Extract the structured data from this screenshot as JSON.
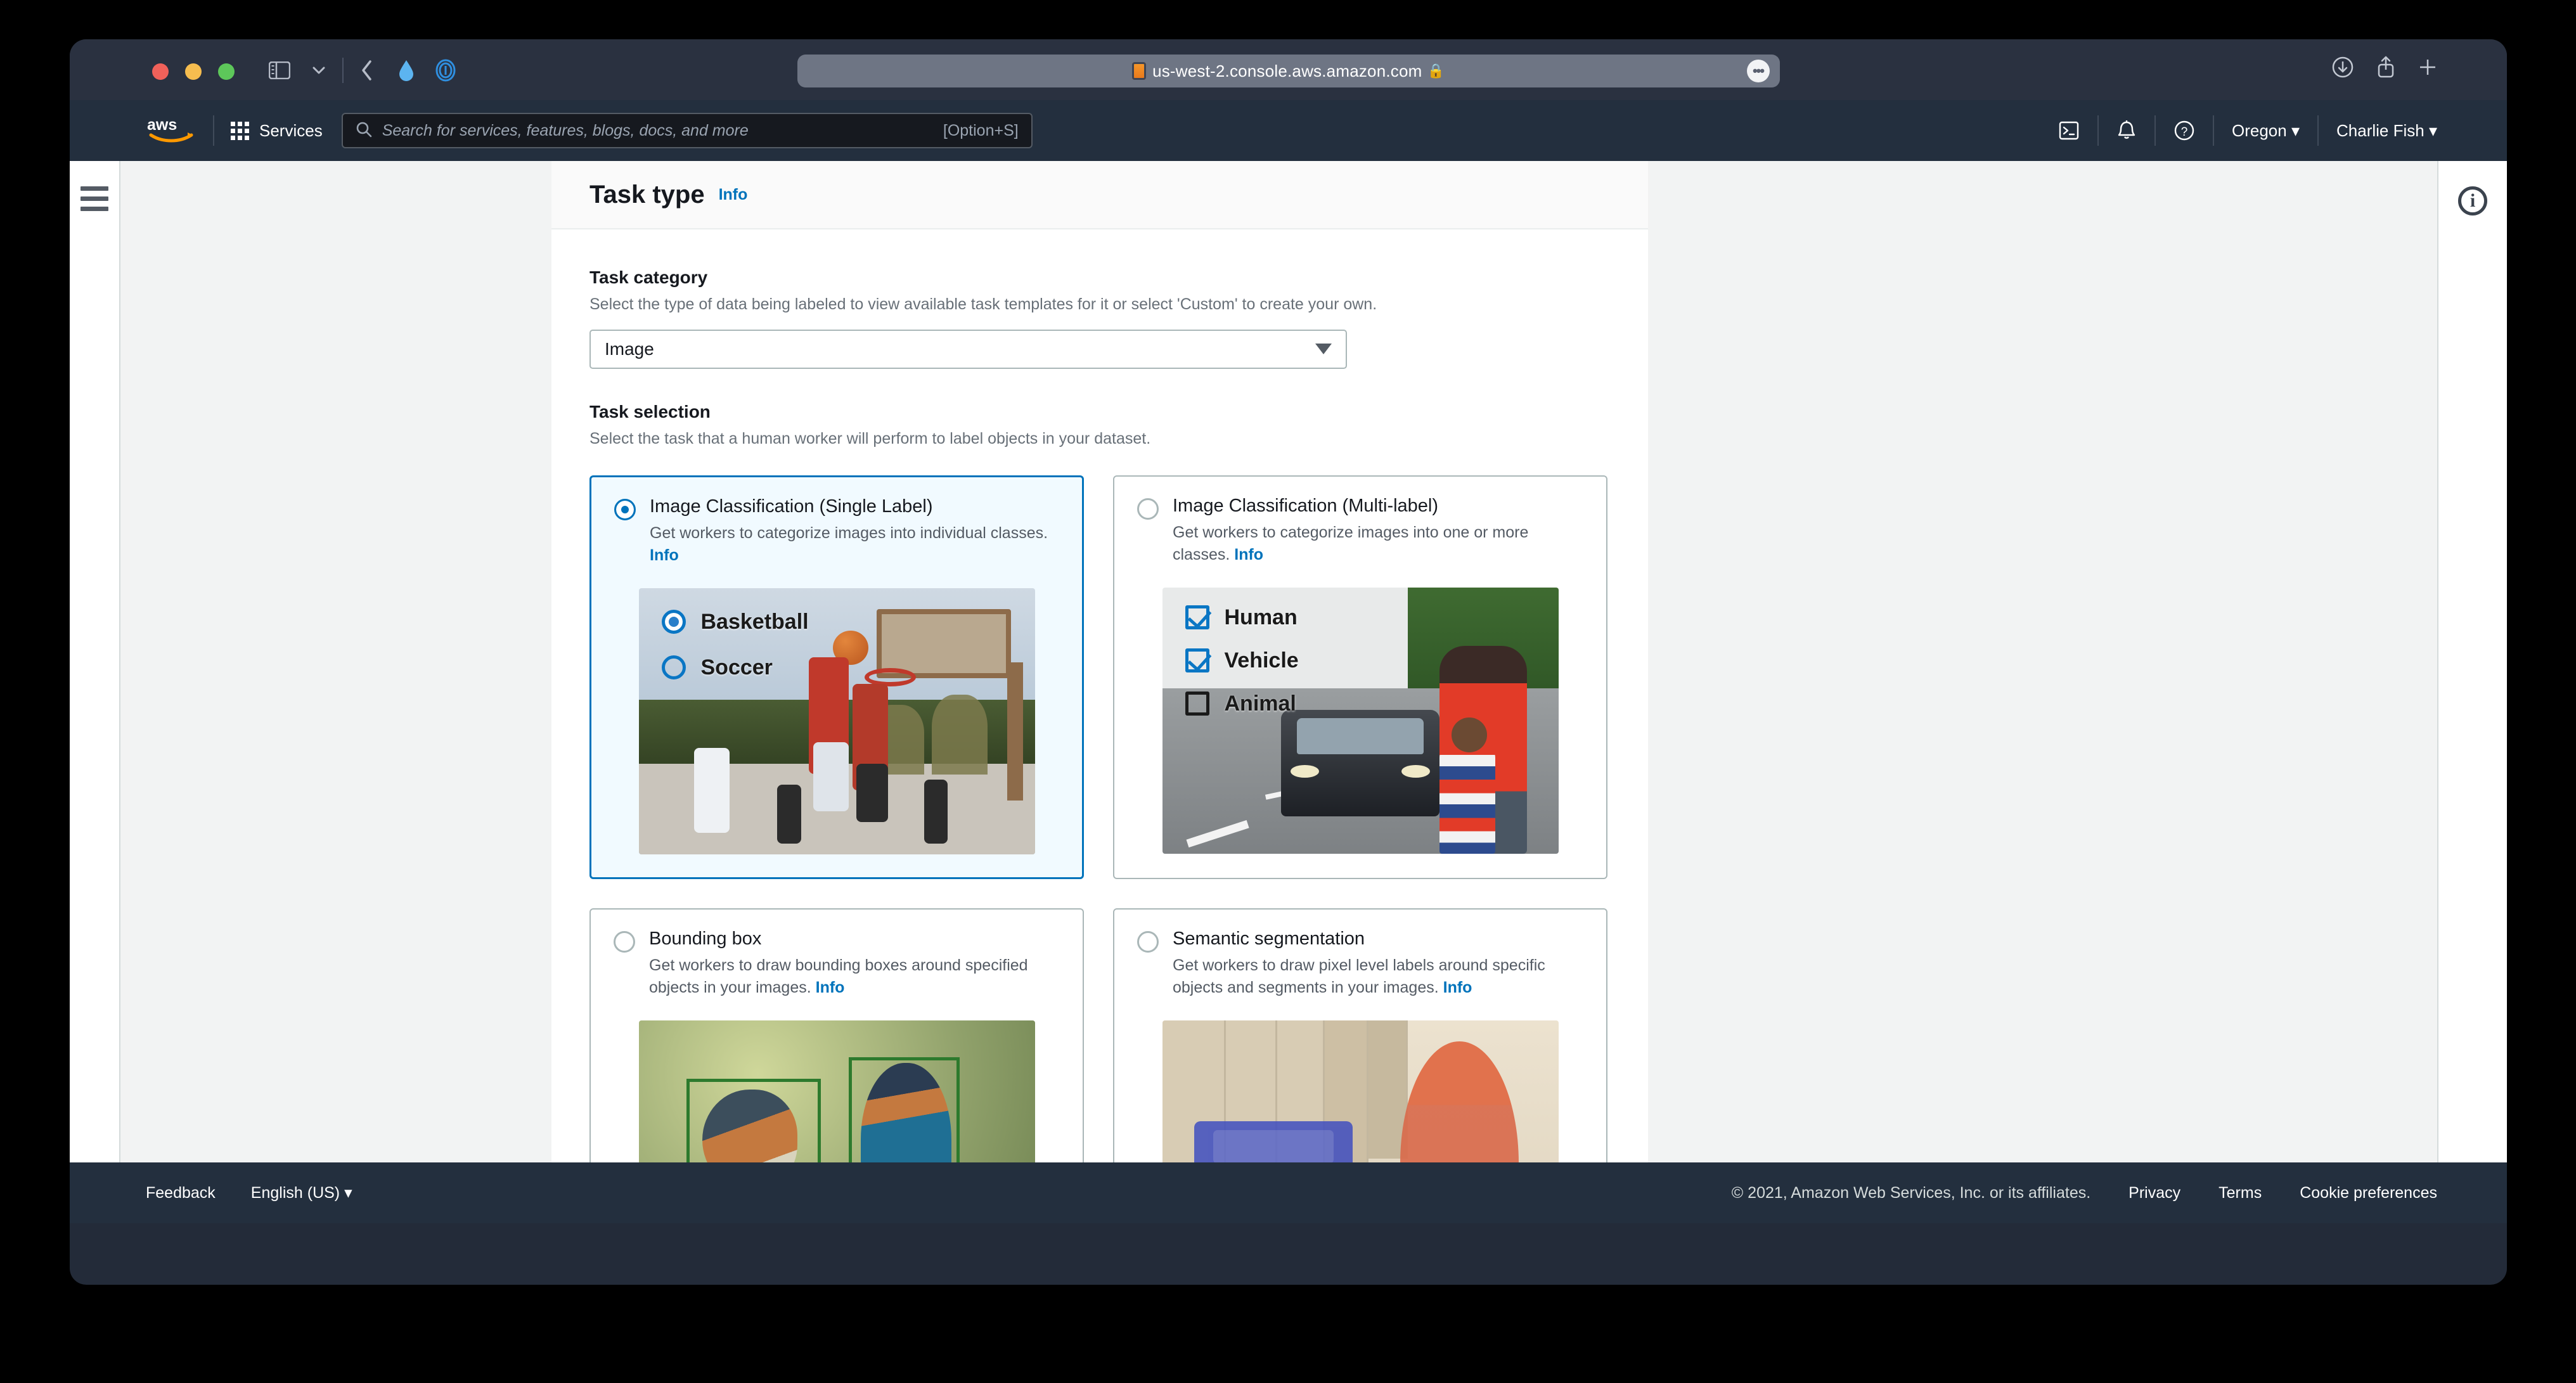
{
  "browser": {
    "url": "us-west-2.console.aws.amazon.com",
    "lock_icon": "lock-icon",
    "favicon": "aws-favicon",
    "traffic_lights": [
      "close",
      "minimize",
      "zoom"
    ],
    "toolbar_icons": [
      "sidebar-toggle-icon",
      "chevron-down-icon",
      "back-icon",
      "extension-icon",
      "privacy-report-icon"
    ],
    "right_icons": [
      "downloads-icon",
      "share-icon",
      "new-tab-icon"
    ],
    "more_icon": "more-icon"
  },
  "awsnav": {
    "logo": "aws-logo",
    "services_label": "Services",
    "search_placeholder": "Search for services, features, blogs, docs, and more",
    "search_shortcut": "[Option+S]",
    "cloudshell_icon": "cloudshell-icon",
    "notifications_icon": "bell-icon",
    "help_icon": "question-circle-icon",
    "region": "Oregon",
    "account": "Charlie Fish"
  },
  "page": {
    "title": "Task type",
    "info_label": "Info",
    "task_category": {
      "label": "Task category",
      "description": "Select the type of data being labeled to view available task templates for it or select 'Custom' to create your own.",
      "value": "Image"
    },
    "task_selection": {
      "label": "Task selection",
      "description": "Select the task that a human worker will perform to label objects in your dataset.",
      "cards": [
        {
          "title": "Image Classification (Single Label)",
          "description": "Get workers to categorize images into individual classes.",
          "info": "Info",
          "selected": true,
          "thumbnail": "basketball-court-photo",
          "overlay_type": "radio",
          "overlay_options": [
            {
              "label": "Basketball",
              "checked": true
            },
            {
              "label": "Soccer",
              "checked": false
            }
          ]
        },
        {
          "title": "Image Classification (Multi-label)",
          "description": "Get workers to categorize images into one or more classes.",
          "info": "Info",
          "selected": false,
          "thumbnail": "road-car-pedestrians-photo",
          "overlay_type": "checkbox",
          "overlay_options": [
            {
              "label": "Human",
              "checked": true
            },
            {
              "label": "Vehicle",
              "checked": true
            },
            {
              "label": "Animal",
              "checked": false
            }
          ]
        },
        {
          "title": "Bounding box",
          "description": "Get workers to draw bounding boxes around specified objects in your images.",
          "info": "Info",
          "selected": false,
          "thumbnail": "two-birds-on-branch-photo",
          "overlay_type": "bounding-boxes",
          "overlay_options": []
        },
        {
          "title": "Semantic segmentation",
          "description": "Get workers to draw pixel level labels around specific objects and segments in your images.",
          "info": "Info",
          "selected": false,
          "thumbnail": "street-woman-car-photo",
          "overlay_type": "segmentation-masks",
          "overlay_options": []
        }
      ]
    }
  },
  "help_panel": {
    "icon": "info-circle-icon"
  },
  "sidebar": {
    "toggle_icon": "hamburger-menu-icon"
  },
  "footer": {
    "feedback": "Feedback",
    "language": "English (US)",
    "copyright": "© 2021, Amazon Web Services, Inc. or its affiliates.",
    "links": [
      "Privacy",
      "Terms",
      "Cookie preferences"
    ]
  },
  "colors": {
    "accent": "#0073bb",
    "nav_bg": "#232f3e",
    "selected_card_bg": "#f1faff",
    "bbox_green": "#2d7a2d"
  }
}
